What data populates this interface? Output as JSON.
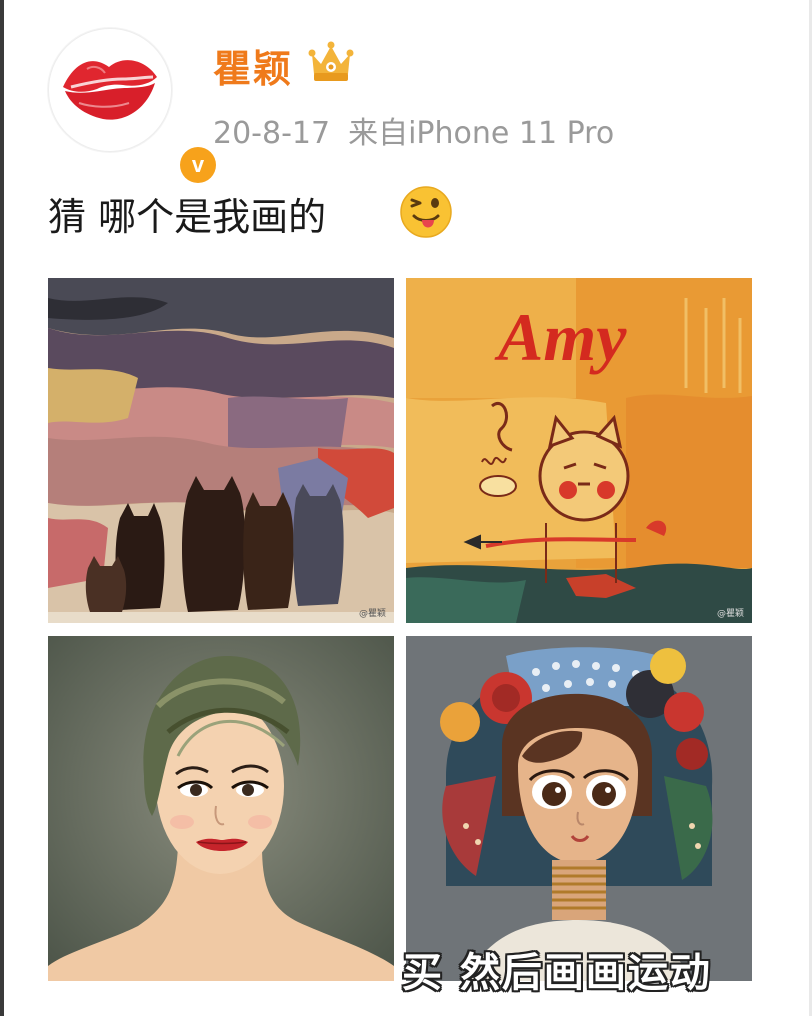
{
  "post": {
    "author": {
      "name": "瞿颖",
      "avatar_icon": "lips-icon",
      "verified_icon": "verified-v-icon",
      "verified_label": "v",
      "badge_icon": "crown-vip-icon"
    },
    "meta": {
      "date": "20-8-17",
      "source": "来自iPhone 11 Pro"
    },
    "text": "猜 哪个是我画的",
    "text_emoji": "tongue-wink-emoji",
    "images": [
      {
        "subject": "abstract-landscape-cats-painting",
        "watermark": "@瞿颖"
      },
      {
        "subject": "amy-kids-cat-painting",
        "painted_text": "Amy",
        "watermark": "@瞿颖"
      },
      {
        "subject": "short-hair-woman-portrait-painting",
        "watermark": ""
      },
      {
        "subject": "girl-with-flower-hat-painting",
        "watermark": ""
      }
    ]
  },
  "caption": "买 然后画画运动",
  "colors": {
    "username": "#ef7a1b",
    "meta": "#9a9a9a",
    "verified": "#f7a21b",
    "lips": "#e0262f"
  }
}
